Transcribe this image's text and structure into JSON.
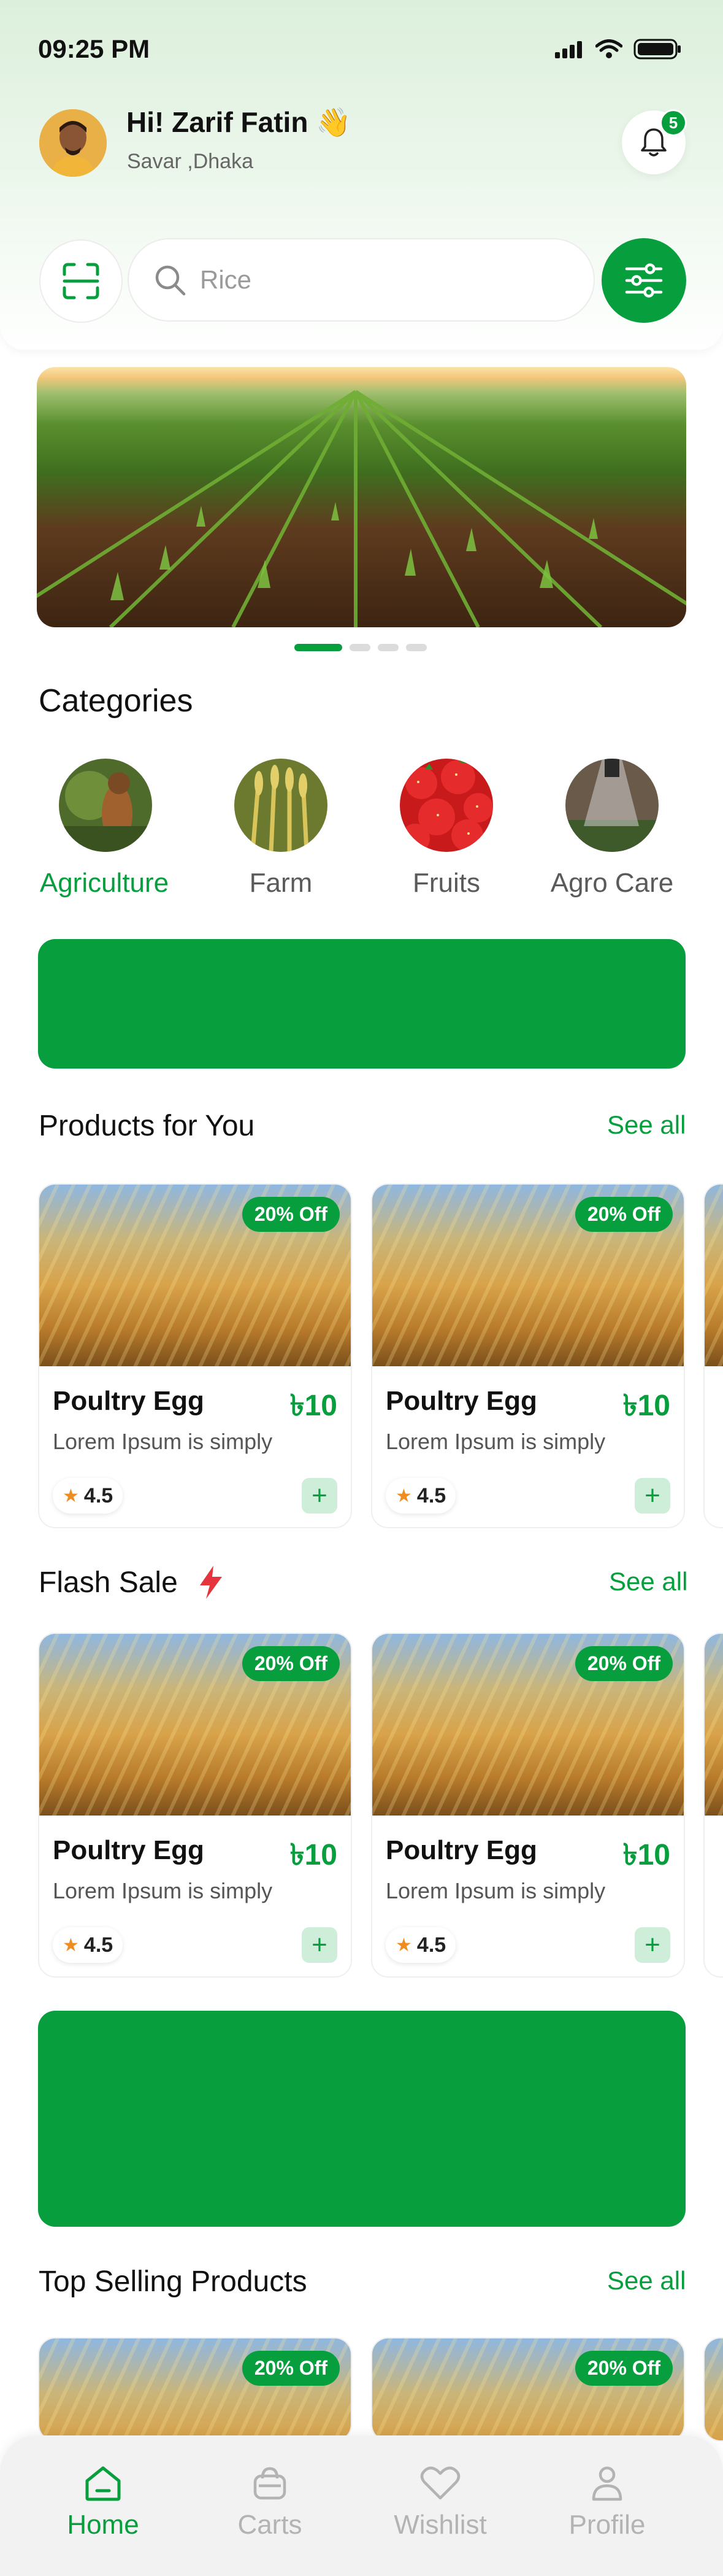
{
  "status_bar": {
    "time": "09:25 PM"
  },
  "header": {
    "greeting": "Hi! Zarif Fatin 👋",
    "location": "Savar ,Dhaka",
    "notification_count": "5"
  },
  "search": {
    "placeholder": "Rice"
  },
  "banner": {
    "slides": 4,
    "active_slide": 1
  },
  "categories": {
    "title": "Categories",
    "items": [
      {
        "label": "Agriculture",
        "active": true
      },
      {
        "label": "Farm",
        "active": false
      },
      {
        "label": "Fruits",
        "active": false
      },
      {
        "label": "Agro Care",
        "active": false
      }
    ]
  },
  "products_for_you": {
    "title": "Products for You",
    "see_all": "See all",
    "items": [
      {
        "badge": "20% Off",
        "name": "Poultry Egg",
        "price": "৳10",
        "desc": "Lorem Ipsum is simply",
        "rating": "4.5"
      },
      {
        "badge": "20% Off",
        "name": "Poultry Egg",
        "price": "৳10",
        "desc": "Lorem Ipsum is simply",
        "rating": "4.5"
      }
    ]
  },
  "flash_sale": {
    "title": "Flash Sale",
    "see_all": "See all",
    "items": [
      {
        "badge": "20% Off",
        "name": "Poultry Egg",
        "price": "৳10",
        "desc": "Lorem Ipsum is simply",
        "rating": "4.5"
      },
      {
        "badge": "20% Off",
        "name": "Poultry Egg",
        "price": "৳10",
        "desc": "Lorem Ipsum is simply",
        "rating": "4.5"
      }
    ]
  },
  "top_selling": {
    "title": "Top Selling Products",
    "see_all": "See all",
    "items": [
      {
        "badge": "20% Off"
      },
      {
        "badge": "20% Off"
      }
    ]
  },
  "bottom_nav": {
    "items": [
      {
        "label": "Home",
        "active": true
      },
      {
        "label": "Carts",
        "active": false
      },
      {
        "label": "Wishlist",
        "active": false
      },
      {
        "label": "Profile",
        "active": false
      }
    ]
  },
  "colors": {
    "brand_green": "#079f3e",
    "rating_star": "#ef8d22",
    "flash_icon": "#e5343d"
  }
}
